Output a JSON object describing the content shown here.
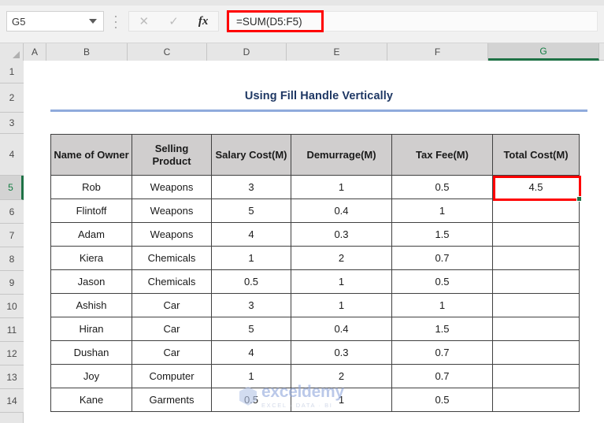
{
  "formula_bar": {
    "name_box_value": "G5",
    "name_box_dropdown_icon": "chevron-down-icon",
    "cancel_icon": "close-icon",
    "confirm_icon": "check-icon",
    "function_icon": "fx-icon",
    "function_label": "fx",
    "formula_value": "=SUM(D5:F5)",
    "highlight_color": "#ff0000"
  },
  "grid": {
    "column_headers": [
      "A",
      "B",
      "C",
      "D",
      "E",
      "F",
      "G"
    ],
    "active_column": "G",
    "row_headers": [
      "1",
      "2",
      "3",
      "4",
      "5",
      "6",
      "7",
      "8",
      "9",
      "10",
      "11",
      "12",
      "13",
      "14"
    ],
    "active_row": "5",
    "active_cell": "G5",
    "header_accent_color": "#1e7145"
  },
  "sheet": {
    "title": "Using Fill Handle Vertically",
    "title_color": "#1f3864",
    "title_rule_color": "#8faadc"
  },
  "table": {
    "headers": [
      "Name of Owner",
      "Selling Product",
      "Salary Cost(M)",
      "Demurrage(M)",
      "Tax Fee(M)",
      "Total Cost(M)"
    ],
    "rows": [
      {
        "owner": "Rob",
        "product": "Weapons",
        "salary": "3",
        "demurrage": "1",
        "tax": "0.5",
        "total": "4.5"
      },
      {
        "owner": "Flintoff",
        "product": "Weapons",
        "salary": "5",
        "demurrage": "0.4",
        "tax": "1",
        "total": ""
      },
      {
        "owner": "Adam",
        "product": "Weapons",
        "salary": "4",
        "demurrage": "0.3",
        "tax": "1.5",
        "total": ""
      },
      {
        "owner": "Kiera",
        "product": "Chemicals",
        "salary": "1",
        "demurrage": "2",
        "tax": "0.7",
        "total": ""
      },
      {
        "owner": "Jason",
        "product": "Chemicals",
        "salary": "0.5",
        "demurrage": "1",
        "tax": "0.5",
        "total": ""
      },
      {
        "owner": "Ashish",
        "product": "Car",
        "salary": "3",
        "demurrage": "1",
        "tax": "1",
        "total": ""
      },
      {
        "owner": "Hiran",
        "product": "Car",
        "salary": "5",
        "demurrage": "0.4",
        "tax": "1.5",
        "total": ""
      },
      {
        "owner": "Dushan",
        "product": "Car",
        "salary": "4",
        "demurrage": "0.3",
        "tax": "0.7",
        "total": ""
      },
      {
        "owner": "Joy",
        "product": "Computer",
        "salary": "1",
        "demurrage": "2",
        "tax": "0.7",
        "total": ""
      },
      {
        "owner": "Kane",
        "product": "Garments",
        "salary": "0.5",
        "demurrage": "1",
        "tax": "0.5",
        "total": ""
      }
    ]
  },
  "watermark": {
    "name": "exceldemy",
    "tagline": "EXCEL · DATA · BI",
    "logo_icon": "hexagon-logo-icon"
  }
}
